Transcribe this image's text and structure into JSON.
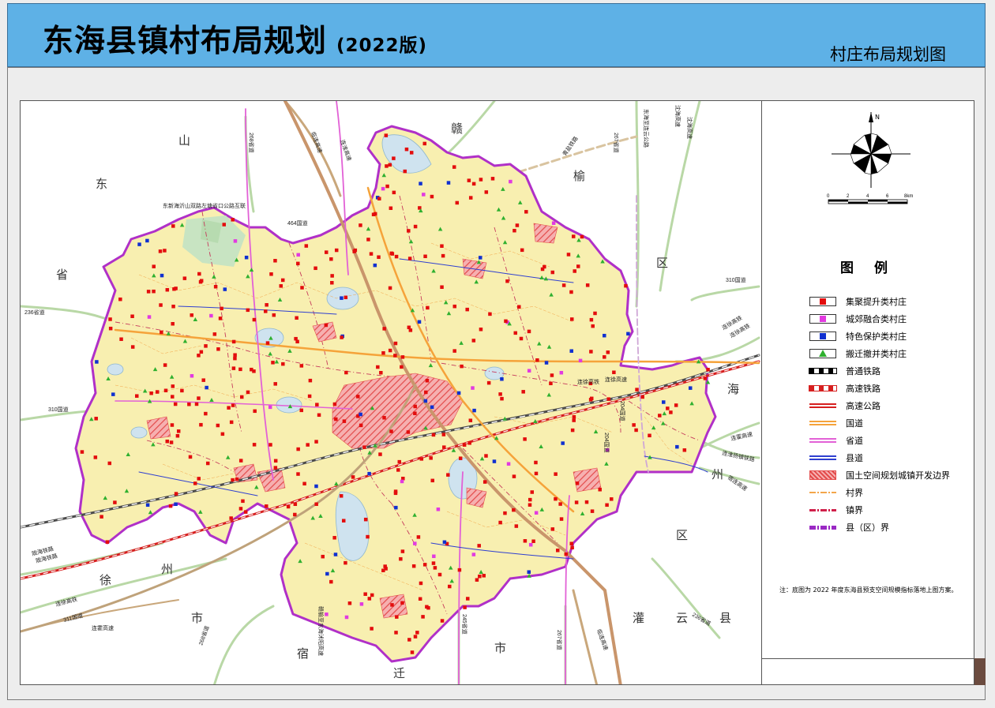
{
  "header": {
    "title": "东海县镇村布局规划",
    "edition": "(2022版)",
    "subtitle": "村庄布局规划图"
  },
  "colors": {
    "header_bg": "#5eb1e6",
    "county_fill": "#f8efb0",
    "county_border": "#b030c8",
    "urban_red": "#e63b3b",
    "village_red": "#e30d0d",
    "village_magenta": "#e23ae0",
    "village_blue": "#1030d0",
    "village_green": "#2fb02f",
    "water": "#cfe3ef",
    "regional_road": "#b5d7a2"
  },
  "compass": {
    "north_label": "N"
  },
  "scale_bar": {
    "ticks": [
      "0",
      "2",
      "4",
      "6",
      "8km"
    ]
  },
  "legend": {
    "title": "图 例",
    "items": [
      {
        "label": "集聚提升类村庄",
        "symbol": "square",
        "color": "#e30d0d"
      },
      {
        "label": "城郊融合类村庄",
        "symbol": "square",
        "color": "#e23ae0"
      },
      {
        "label": "特色保护类村庄",
        "symbol": "square",
        "color": "#1030d0"
      },
      {
        "label": "搬迁撤并类村庄",
        "symbol": "triangle",
        "color": "#2fb02f"
      },
      {
        "label": "普通铁路",
        "symbol": "rail",
        "color": "#000000"
      },
      {
        "label": "高速铁路",
        "symbol": "hsr",
        "color": "#d61f1f"
      },
      {
        "label": "高速公路",
        "symbol": "line",
        "color": "#d61f1f"
      },
      {
        "label": "国道",
        "symbol": "line",
        "color": "#f5a33a"
      },
      {
        "label": "省道",
        "symbol": "line",
        "color": "#e261d6"
      },
      {
        "label": "县道",
        "symbol": "line",
        "color": "#2f3fd0"
      },
      {
        "label": "国土空间规划城镇开发边界",
        "symbol": "hatch",
        "color": "#e63b3b"
      },
      {
        "label": "村界",
        "symbol": "dashdot",
        "color": "#f3a64a"
      },
      {
        "label": "镇界",
        "symbol": "dashdot",
        "color": "#d0204a"
      },
      {
        "label": "县（区）界",
        "symbol": "dashdot",
        "color": "#9a29c4"
      }
    ],
    "note": "注：底图为 2022 年度东海县预支空间规模指标落地上图方案。"
  },
  "map_labels": {
    "neighbors": [
      "山",
      "东",
      "省",
      "赣",
      "榆",
      "区",
      "海",
      "州",
      "区",
      "灌",
      "云",
      "县",
      "徐",
      "州",
      "市",
      "宿",
      "迁",
      "市"
    ],
    "roads": [
      "236省道",
      "310国道",
      "310国道",
      "236省道",
      "连徐高速",
      "连霍高速",
      "陇海铁路",
      "连徐高铁",
      "311国道",
      "连霍高速",
      "连淮扬镇铁路",
      "宿连高速",
      "连徐高铁",
      "204国道",
      "沈海高速",
      "267省道",
      "245省道",
      "267省道",
      "临连高速",
      "临连高速",
      "268省道",
      "268省道",
      "连淮高速",
      "东海至连云公路",
      "青盐铁路",
      "东新海沂山双路左塘省口公路互联",
      "陇海铁路",
      "连徐高铁",
      "204国道",
      "沈海高速",
      "连徐高铁",
      "赣榆至东海沭阳高速",
      "464国道"
    ]
  }
}
